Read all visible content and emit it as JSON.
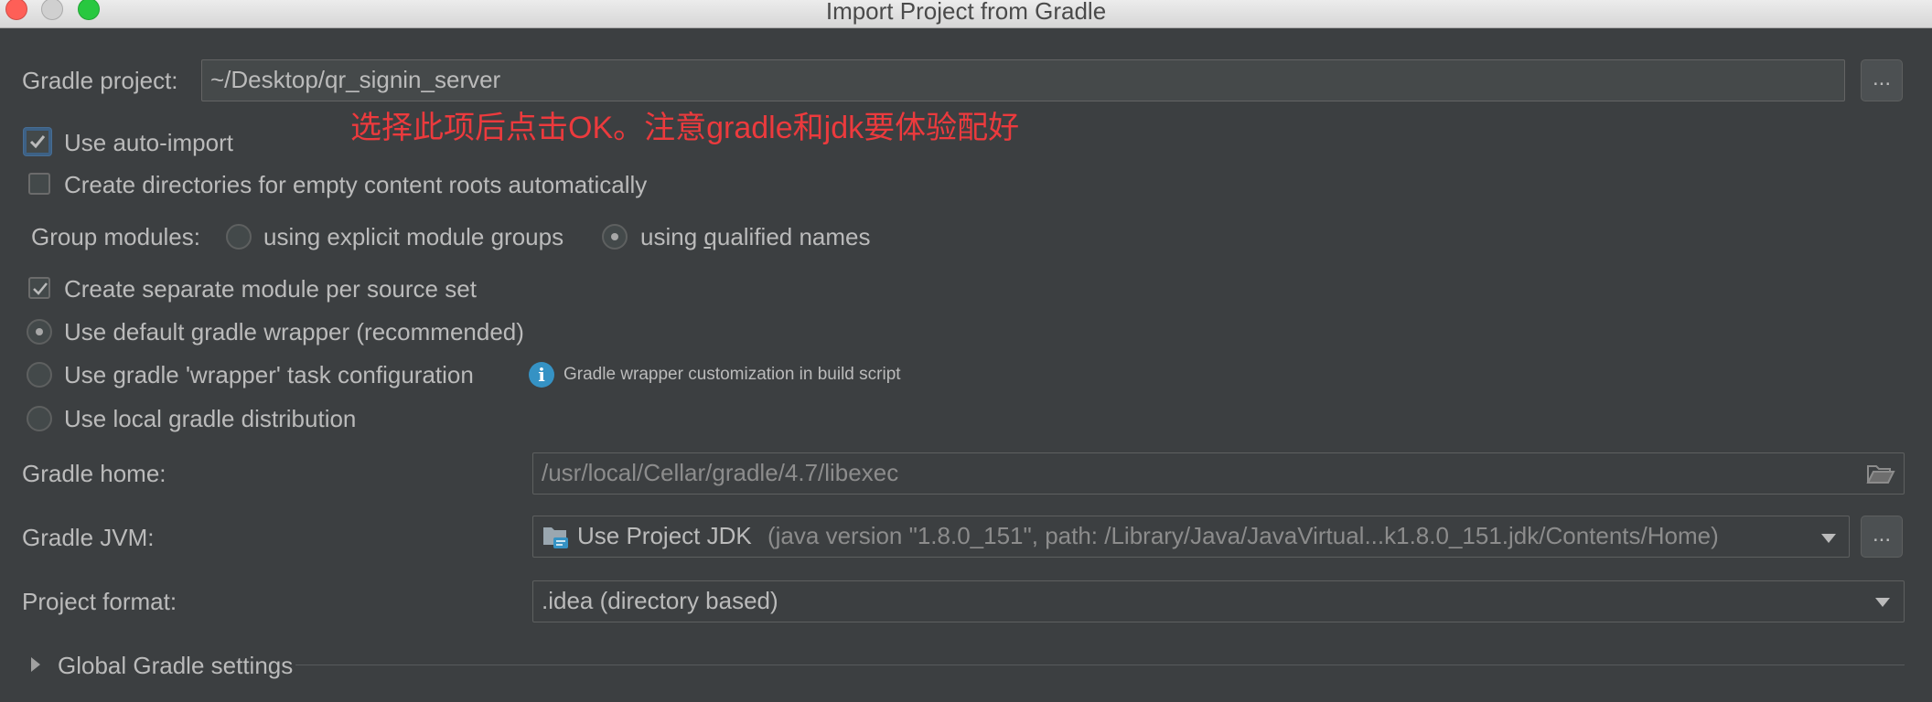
{
  "window": {
    "title": "Import Project from Gradle"
  },
  "gradle_project": {
    "label": "Gradle project:",
    "value": "~/Desktop/qr_signin_server",
    "browse_label": "..."
  },
  "annotation": {
    "text": "选择此项后点击OK。注意gradle和jdk要体验配好",
    "color": "#ec3a3d"
  },
  "options": {
    "auto_import": {
      "label": "Use auto-import",
      "checked": true
    },
    "create_dirs": {
      "label": "Create directories for empty content roots automatically",
      "checked": false
    },
    "group_modules": {
      "label": "Group modules:",
      "explicit": {
        "label": "using explicit module groups",
        "selected": false
      },
      "qualified": {
        "label_pre": "using ",
        "label_mnemonic": "q",
        "label_post": "ualified names",
        "selected": true
      }
    },
    "separate_module": {
      "label": "Create separate module per source set",
      "checked": true
    },
    "default_wrapper": {
      "label": "Use default gradle wrapper (recommended)",
      "selected": true
    },
    "wrapper_task": {
      "label": "Use gradle 'wrapper' task configuration",
      "selected": false
    },
    "wrapper_info": {
      "icon": "info-icon",
      "text": "Gradle wrapper customization in build script"
    },
    "local_distribution": {
      "label": "Use local gradle distribution",
      "selected": false
    }
  },
  "gradle_home": {
    "label": "Gradle home:",
    "value": "/usr/local/Cellar/gradle/4.7/libexec",
    "icon": "folder-icon"
  },
  "gradle_jvm": {
    "label": "Gradle JVM:",
    "value_main": "Use Project JDK",
    "value_detail": "(java version \"1.8.0_151\", path: /Library/Java/JavaVirtual...k1.8.0_151.jdk/Contents/Home)",
    "icon": "jdk-folder-icon",
    "browse_label": "..."
  },
  "project_format": {
    "label": "Project format:",
    "value": ".idea (directory based)"
  },
  "global_settings": {
    "label": "Global Gradle settings",
    "expanded": false
  },
  "colors": {
    "background": "#3c3f41",
    "field_bg": "#45494a",
    "text": "#bbbbbb",
    "disabled_text": "#8c8c8c",
    "focus": "#3d6185",
    "info_blue": "#3592c4"
  }
}
